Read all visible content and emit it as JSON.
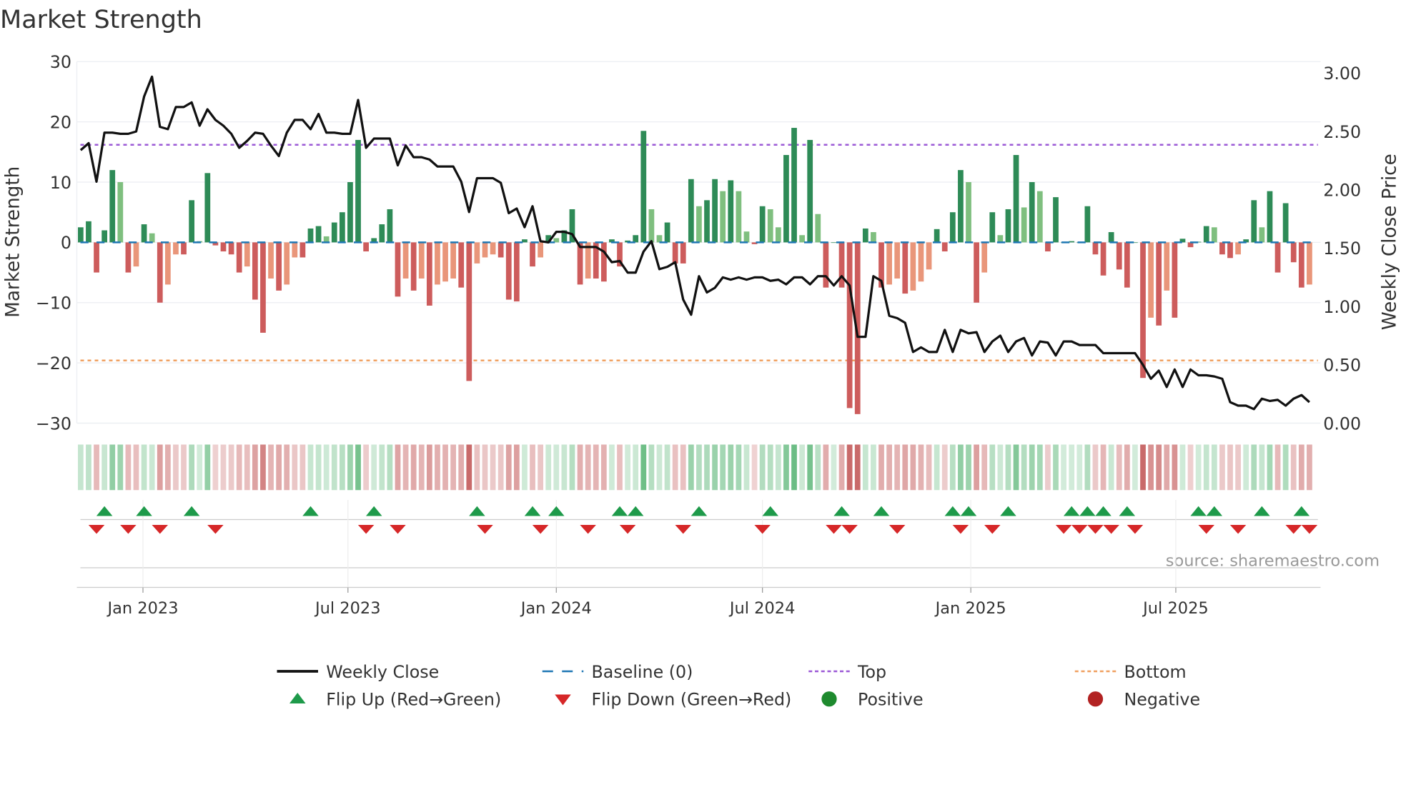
{
  "chart_data": {
    "type": "bar+line",
    "title": "Market Strength",
    "ylabel": "Market Strength",
    "y2label": "Weekly Close Price",
    "ylim": [
      -30,
      30
    ],
    "y2lim": [
      0,
      3.0
    ],
    "yticks": [
      "30",
      "20",
      "10",
      "0",
      "−10",
      "−20",
      "−30"
    ],
    "ytick_values": [
      30,
      20,
      10,
      0,
      -10,
      -20,
      -30
    ],
    "y2ticks": [
      "3.00",
      "2.50",
      "2.00",
      "1.50",
      "1.00",
      "0.50",
      "0.00"
    ],
    "y2tick_values": [
      3.0,
      2.5,
      2.0,
      1.5,
      1.0,
      0.5,
      0.0
    ],
    "xticks": [
      {
        "label": "Jan 2023",
        "date": "2023-01-01"
      },
      {
        "label": "Jul 2023",
        "date": "2023-07-01"
      },
      {
        "label": "Jan 2024",
        "date": "2024-01-01"
      },
      {
        "label": "Jul 2024",
        "date": "2024-07-01"
      },
      {
        "label": "Jan 2025",
        "date": "2025-01-01"
      },
      {
        "label": "Jul 2025",
        "date": "2025-07-01"
      }
    ],
    "start_date": "2022-11-07",
    "interval_days": 7,
    "top_level": 16.2,
    "bottom_level": -19.6,
    "baseline": 0,
    "strength": [
      2.5,
      3.5,
      -5,
      2,
      12,
      10,
      -5,
      -4,
      3,
      1.5,
      -10,
      -7,
      -2,
      -2,
      7,
      0.2,
      11.5,
      -0.5,
      -1.5,
      -2,
      -5,
      -4,
      -9.5,
      -15,
      -6,
      -8,
      -7,
      -2.5,
      -2.5,
      2.3,
      2.7,
      1,
      3.3,
      5,
      10,
      17,
      -1.5,
      0.7,
      3,
      5.5,
      -9,
      -6,
      -8,
      -6,
      -10.5,
      -7,
      -6.5,
      -6,
      -7.5,
      -23,
      -3.5,
      -2.5,
      -2,
      -2.5,
      -9.5,
      -9.8,
      0.5,
      -4,
      -2.5,
      1.2,
      0.7,
      2,
      5.5,
      -7,
      -6,
      -6,
      -6.5,
      0.5,
      -4,
      0.3,
      1.2,
      18.5,
      5.5,
      1.2,
      3.3,
      -3.5,
      -3.5,
      10.5,
      6,
      7,
      10.5,
      8.5,
      10.3,
      8.5,
      1.8,
      -0.3,
      6,
      5.5,
      2.5,
      14.5,
      19,
      1.2,
      17,
      4.7,
      -7.5,
      0,
      -7.5,
      -27.5,
      -28.5,
      2.3,
      1.7,
      -7.5,
      -7,
      -6,
      -8.5,
      -8,
      -6.5,
      -4.5,
      2.2,
      -1.5,
      5,
      12,
      10,
      -10,
      -5,
      5,
      1.2,
      5.5,
      14.5,
      5.8,
      10,
      8.5,
      -1.5,
      7.5,
      0,
      0.2,
      0,
      6,
      -2,
      -5.5,
      1.7,
      -4.5,
      -7.5,
      0,
      -22.5,
      -12.5,
      -13.8,
      -8,
      -12.5,
      0.6,
      -0.8,
      0.1,
      2.7,
      2.5,
      -2,
      -2.6,
      -2,
      0.5,
      7,
      2.5,
      8.5,
      -5,
      6.5,
      -3.3,
      -7.5,
      -7
    ],
    "weekly_close": [
      2.34,
      2.4,
      2.07,
      2.49,
      2.49,
      2.48,
      2.48,
      2.5,
      2.8,
      2.97,
      2.54,
      2.52,
      2.71,
      2.71,
      2.75,
      2.55,
      2.69,
      2.6,
      2.55,
      2.48,
      2.36,
      2.42,
      2.49,
      2.48,
      2.38,
      2.29,
      2.49,
      2.6,
      2.6,
      2.52,
      2.65,
      2.49,
      2.49,
      2.48,
      2.48,
      2.77,
      2.36,
      2.44,
      2.44,
      2.44,
      2.21,
      2.38,
      2.28,
      2.28,
      2.26,
      2.2,
      2.2,
      2.2,
      2.07,
      1.81,
      2.1,
      2.1,
      2.1,
      2.06,
      1.8,
      1.84,
      1.68,
      1.86,
      1.56,
      1.55,
      1.64,
      1.64,
      1.62,
      1.51,
      1.51,
      1.51,
      1.47,
      1.38,
      1.39,
      1.29,
      1.29,
      1.47,
      1.56,
      1.32,
      1.34,
      1.38,
      1.06,
      0.93,
      1.26,
      1.12,
      1.16,
      1.25,
      1.23,
      1.25,
      1.23,
      1.25,
      1.25,
      1.22,
      1.23,
      1.19,
      1.25,
      1.25,
      1.19,
      1.26,
      1.26,
      1.18,
      1.26,
      1.18,
      0.74,
      0.74,
      1.26,
      1.22,
      0.92,
      0.9,
      0.86,
      0.61,
      0.65,
      0.61,
      0.61,
      0.8,
      0.61,
      0.8,
      0.77,
      0.78,
      0.61,
      0.7,
      0.75,
      0.61,
      0.7,
      0.73,
      0.58,
      0.7,
      0.69,
      0.58,
      0.7,
      0.7,
      0.67,
      0.67,
      0.67,
      0.6,
      0.6,
      0.6,
      0.6,
      0.6,
      0.5,
      0.38,
      0.45,
      0.31,
      0.46,
      0.31,
      0.46,
      0.41,
      0.41,
      0.4,
      0.38,
      0.18,
      0.15,
      0.15,
      0.12,
      0.21,
      0.19,
      0.2,
      0.15,
      0.21,
      0.24,
      0.18
    ],
    "flip_up_weeks": [
      3,
      8,
      14,
      29,
      37,
      50,
      57,
      60,
      68,
      70,
      78,
      87,
      96,
      101,
      110,
      112,
      117,
      125,
      127,
      129,
      132,
      141,
      143,
      149,
      154
    ],
    "flip_down_weeks": [
      2,
      6,
      10,
      17,
      36,
      40,
      51,
      58,
      64,
      69,
      76,
      86,
      95,
      97,
      103,
      111,
      115,
      124,
      126,
      128,
      130,
      133,
      142,
      146,
      153,
      155
    ],
    "legend": [
      {
        "label": "Weekly Close",
        "kind": "line",
        "color": "#111111"
      },
      {
        "label": "Baseline (0)",
        "kind": "dash",
        "color": "#1f77b4"
      },
      {
        "label": "Top",
        "kind": "dot",
        "color": "#9b59d6"
      },
      {
        "label": "Bottom",
        "kind": "dot",
        "color": "#f0a060"
      },
      {
        "label": "Flip Up (Red→Green)",
        "kind": "up",
        "color": "#1e9a4a"
      },
      {
        "label": "Flip Down (Green→Red)",
        "kind": "down",
        "color": "#d62728"
      },
      {
        "label": "Positive",
        "kind": "circle",
        "color": "#1e8a2e"
      },
      {
        "label": "Negative",
        "kind": "circle",
        "color": "#b22222"
      }
    ],
    "legend_placement": "bottom",
    "source": "source: sharemaestro.com",
    "colors": {
      "pos_strong": "#2e8b57",
      "pos_weak": "#7fbf7f",
      "neg_strong": "#cd5c5c",
      "neg_weak": "#e9967a"
    }
  }
}
